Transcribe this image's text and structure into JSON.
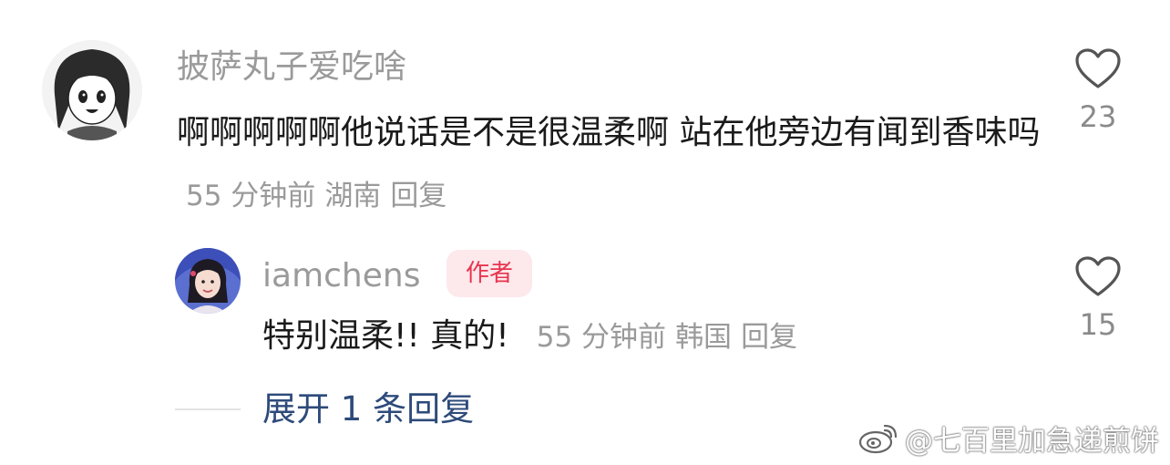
{
  "comment1": {
    "username": "披萨丸子爱吃啥",
    "text": "啊啊啊啊啊他说话是不是很温柔啊 站在他旁边有闻到香味吗",
    "time": "55 分钟前",
    "location": "湖南",
    "reply_label": "回复",
    "likes": "23"
  },
  "comment2": {
    "username": "iamchens",
    "badge": "作者",
    "text": "特别温柔!! 真的!",
    "time": "55 分钟前",
    "location": "韩国",
    "reply_label": "回复",
    "likes": "15"
  },
  "expand_replies": "展开 1 条回复",
  "watermark": "@七百里加急递煎饼",
  "colors": {
    "username": "#9a9a9a",
    "text": "#1a1a1a",
    "badge_bg": "#fde8eb",
    "badge_text": "#e8344e",
    "expand_link": "#2d4a7a"
  },
  "icons": {
    "like": "heart-outline-icon",
    "watermark": "weibo-logo-icon"
  }
}
